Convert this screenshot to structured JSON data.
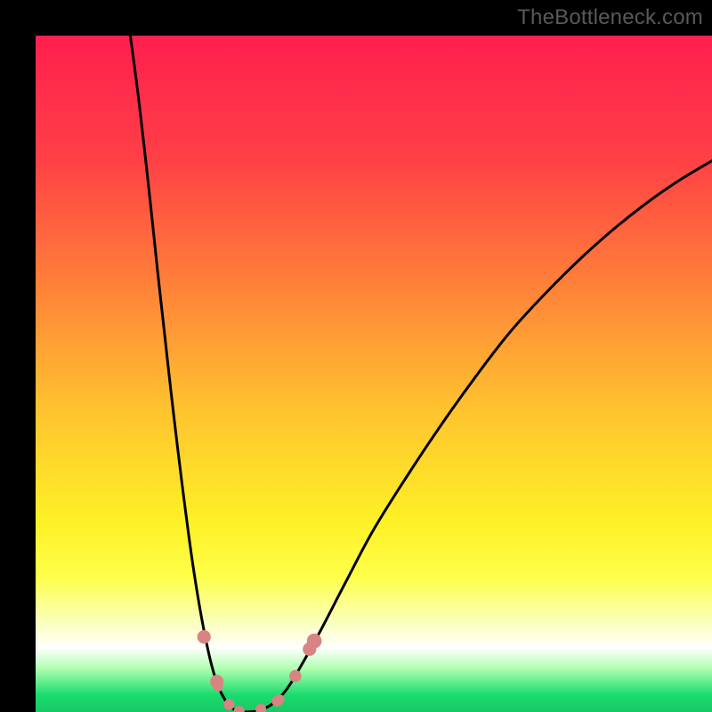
{
  "watermark": "TheBottleneck.com",
  "colors": {
    "frame": "#000000",
    "watermark": "#595959",
    "gradient_stops": [
      {
        "offset": 0.0,
        "color": "#ff1f4e"
      },
      {
        "offset": 0.18,
        "color": "#ff3f46"
      },
      {
        "offset": 0.35,
        "color": "#ff7a3a"
      },
      {
        "offset": 0.55,
        "color": "#ffc22f"
      },
      {
        "offset": 0.72,
        "color": "#fef126"
      },
      {
        "offset": 0.8,
        "color": "#feff4a"
      },
      {
        "offset": 0.86,
        "color": "#fbffb0"
      },
      {
        "offset": 0.905,
        "color": "#ffffff"
      },
      {
        "offset": 0.935,
        "color": "#b1ffb1"
      },
      {
        "offset": 0.975,
        "color": "#1adc6e"
      },
      {
        "offset": 1.0,
        "color": "#17c864"
      }
    ],
    "curve": "#000000",
    "marker_fill": "#d98383",
    "marker_stroke": "#d98383"
  },
  "chart_data": {
    "type": "line",
    "title": "",
    "xlabel": "",
    "ylabel": "",
    "xlim": [
      0,
      100
    ],
    "ylim": [
      0,
      100
    ],
    "curve_left": [
      {
        "x": 14.0,
        "y": 100.0
      },
      {
        "x": 15.0,
        "y": 92.5
      },
      {
        "x": 16.0,
        "y": 84.0
      },
      {
        "x": 17.0,
        "y": 75.0
      },
      {
        "x": 18.0,
        "y": 65.5
      },
      {
        "x": 19.0,
        "y": 56.5
      },
      {
        "x": 20.0,
        "y": 47.5
      },
      {
        "x": 21.0,
        "y": 39.0
      },
      {
        "x": 22.0,
        "y": 31.0
      },
      {
        "x": 23.0,
        "y": 23.5
      },
      {
        "x": 24.0,
        "y": 17.0
      },
      {
        "x": 25.0,
        "y": 11.5
      },
      {
        "x": 26.0,
        "y": 7.0
      },
      {
        "x": 27.0,
        "y": 3.8
      },
      {
        "x": 28.0,
        "y": 1.8
      },
      {
        "x": 29.0,
        "y": 0.6
      },
      {
        "x": 30.0,
        "y": 0.1
      },
      {
        "x": 31.0,
        "y": 0.0
      }
    ],
    "curve_right": [
      {
        "x": 31.0,
        "y": 0.0
      },
      {
        "x": 33.0,
        "y": 0.2
      },
      {
        "x": 35.0,
        "y": 1.2
      },
      {
        "x": 37.0,
        "y": 3.2
      },
      {
        "x": 39.0,
        "y": 6.4
      },
      {
        "x": 42.0,
        "y": 11.8
      },
      {
        "x": 46.0,
        "y": 19.5
      },
      {
        "x": 50.0,
        "y": 27.0
      },
      {
        "x": 55.0,
        "y": 35.0
      },
      {
        "x": 60.0,
        "y": 42.5
      },
      {
        "x": 65.0,
        "y": 49.5
      },
      {
        "x": 70.0,
        "y": 56.0
      },
      {
        "x": 75.0,
        "y": 61.5
      },
      {
        "x": 80.0,
        "y": 66.5
      },
      {
        "x": 85.0,
        "y": 71.0
      },
      {
        "x": 90.0,
        "y": 75.0
      },
      {
        "x": 95.0,
        "y": 78.5
      },
      {
        "x": 100.0,
        "y": 81.5
      }
    ],
    "markers": [
      {
        "x": 24.9,
        "y": 11.1,
        "r": 1.0
      },
      {
        "x": 26.8,
        "y": 4.5,
        "r": 1.0
      },
      {
        "x": 27.0,
        "y": 3.7,
        "r": 0.7
      },
      {
        "x": 28.6,
        "y": 1.1,
        "r": 0.8
      },
      {
        "x": 30.1,
        "y": 0.1,
        "r": 0.8
      },
      {
        "x": 33.3,
        "y": 0.4,
        "r": 0.8
      },
      {
        "x": 35.7,
        "y": 1.6,
        "r": 0.8
      },
      {
        "x": 36.1,
        "y": 1.9,
        "r": 0.7
      },
      {
        "x": 38.4,
        "y": 5.3,
        "r": 0.9
      },
      {
        "x": 40.5,
        "y": 9.3,
        "r": 1.0
      },
      {
        "x": 41.2,
        "y": 10.5,
        "r": 1.1
      }
    ]
  }
}
